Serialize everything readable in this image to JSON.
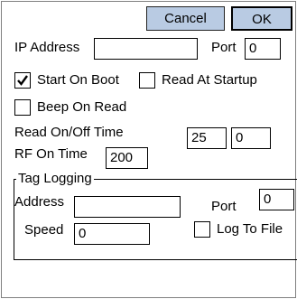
{
  "toolbar": {
    "cancel_label": "Cancel",
    "ok_label": "OK"
  },
  "network": {
    "ip_label": "IP Address",
    "ip_value": "",
    "port_label": "Port",
    "port_value": "0"
  },
  "options": {
    "start_on_boot": {
      "label": "Start On Boot",
      "checked": true
    },
    "read_at_startup": {
      "label": "Read At Startup",
      "checked": false
    },
    "beep_on_read": {
      "label": "Beep On Read",
      "checked": false
    }
  },
  "timing": {
    "read_label": "Read On/Off Time",
    "read_on": "25",
    "read_off": "0",
    "rf_label": "RF On Time",
    "rf_value": "200"
  },
  "tag_logging": {
    "legend": "Tag Logging",
    "address_label": "Address",
    "address_value": "",
    "port_label": "Port",
    "port_value": "0",
    "speed_label": "Speed",
    "speed_value": "0",
    "log_to_file": {
      "label": "Log To File",
      "checked": false
    }
  }
}
